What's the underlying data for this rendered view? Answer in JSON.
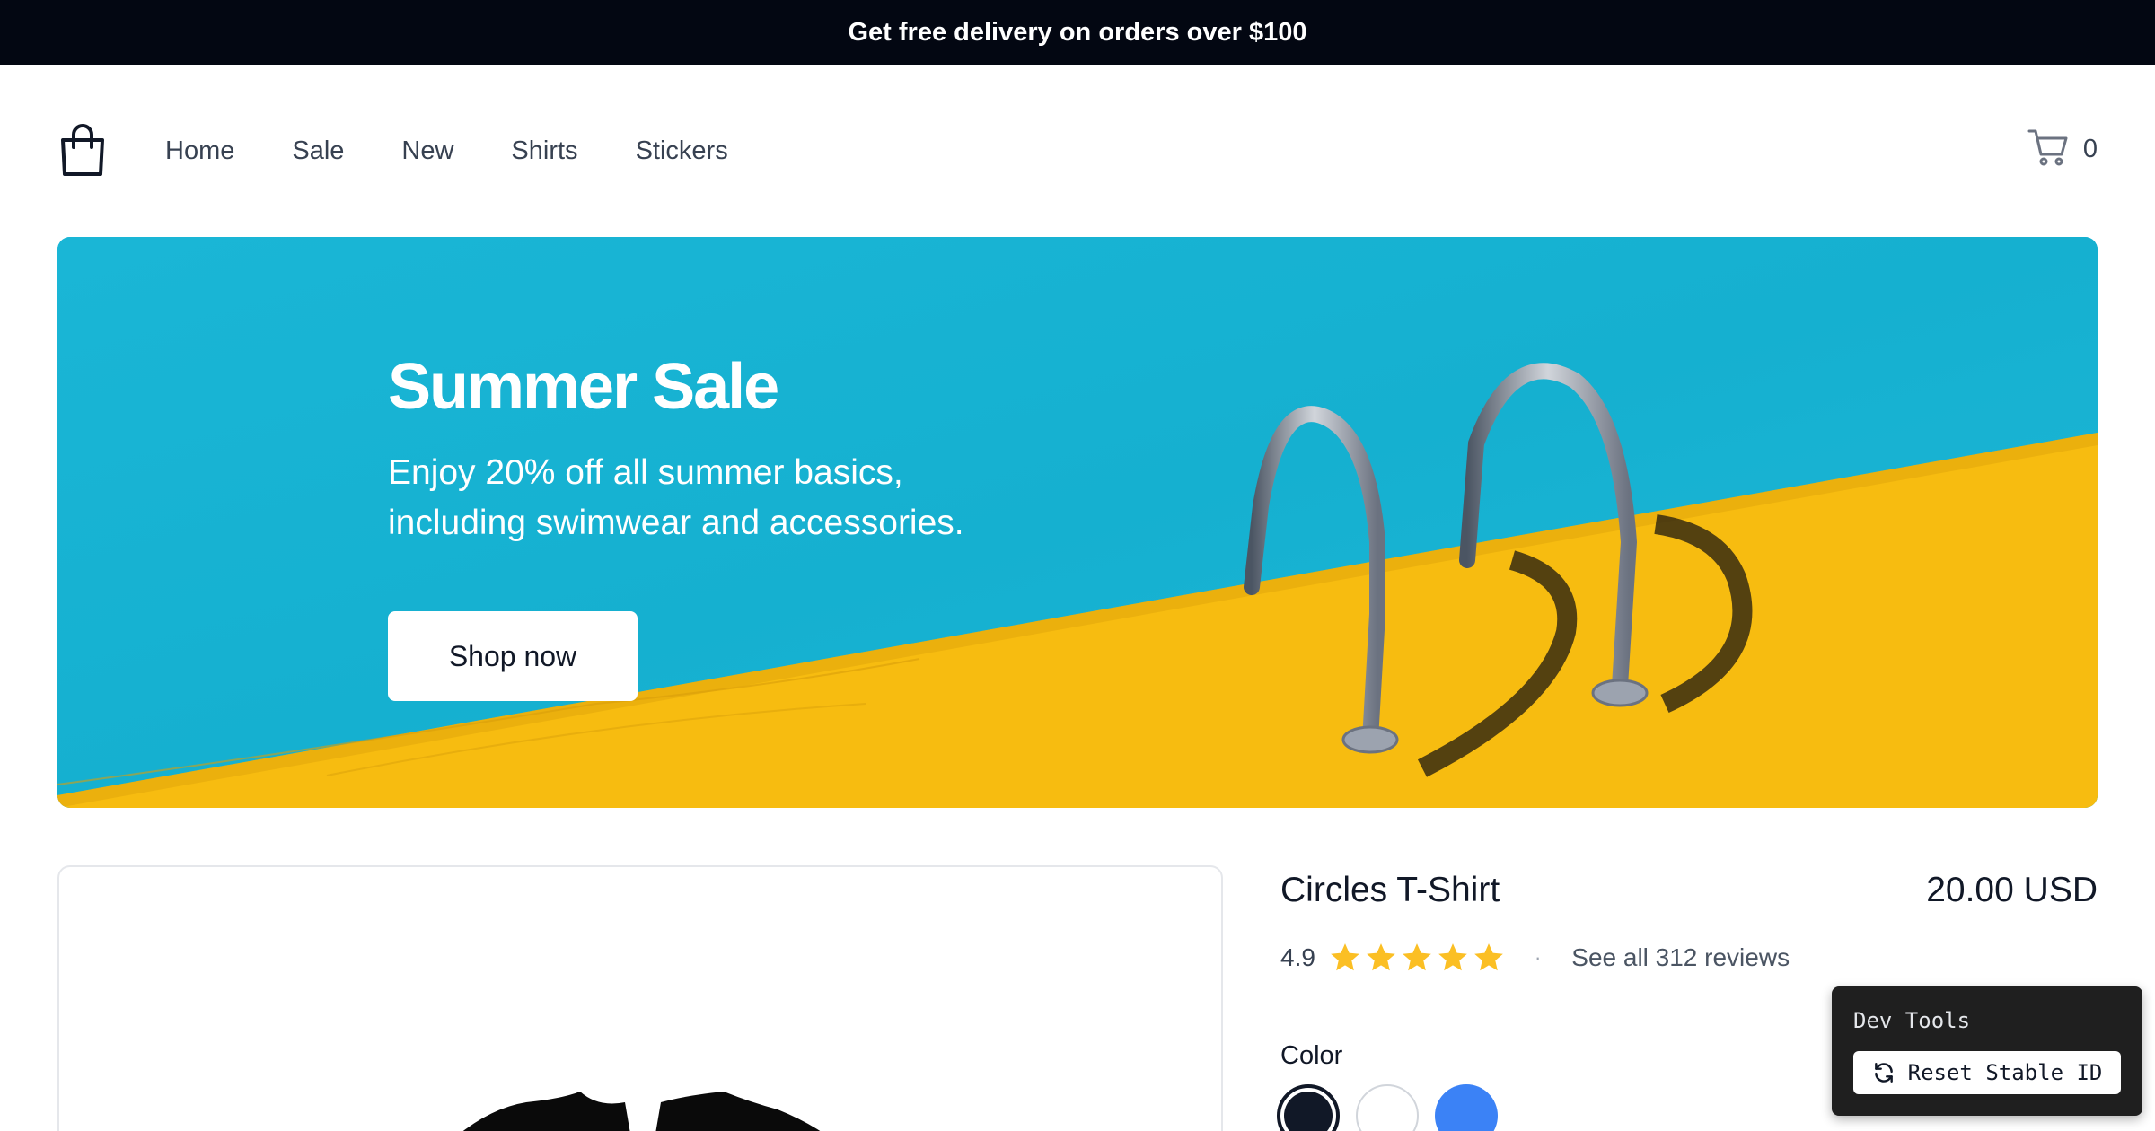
{
  "announcement": {
    "text": "Get free delivery on orders over $100"
  },
  "header": {
    "logo_icon": "shopping-bag-icon",
    "nav": [
      {
        "label": "Home"
      },
      {
        "label": "Sale"
      },
      {
        "label": "New"
      },
      {
        "label": "Shirts"
      },
      {
        "label": "Stickers"
      }
    ],
    "cart": {
      "icon": "cart-icon",
      "count": "0"
    }
  },
  "hero": {
    "title": "Summer Sale",
    "subtitle": "Enjoy 20% off all summer basics, including swimwear and accessories.",
    "button_label": "Shop now",
    "colors": {
      "water": "#1ab4d4",
      "deck": "#f7bc10"
    }
  },
  "product": {
    "title": "Circles T-Shirt",
    "price": "20.00 USD",
    "rating": {
      "value": "4.9",
      "stars": 5,
      "separator": "·",
      "reviews_link": "See all 312 reviews"
    },
    "color_label": "Color",
    "colors": [
      {
        "name": "black",
        "hex": "#111827",
        "selected": true
      },
      {
        "name": "white",
        "hex": "#ffffff",
        "selected": false
      },
      {
        "name": "blue",
        "hex": "#3b82f6",
        "selected": false
      }
    ]
  },
  "devtools": {
    "title": "Dev Tools",
    "reset_label": "Reset Stable ID",
    "reset_icon": "refresh-icon"
  }
}
